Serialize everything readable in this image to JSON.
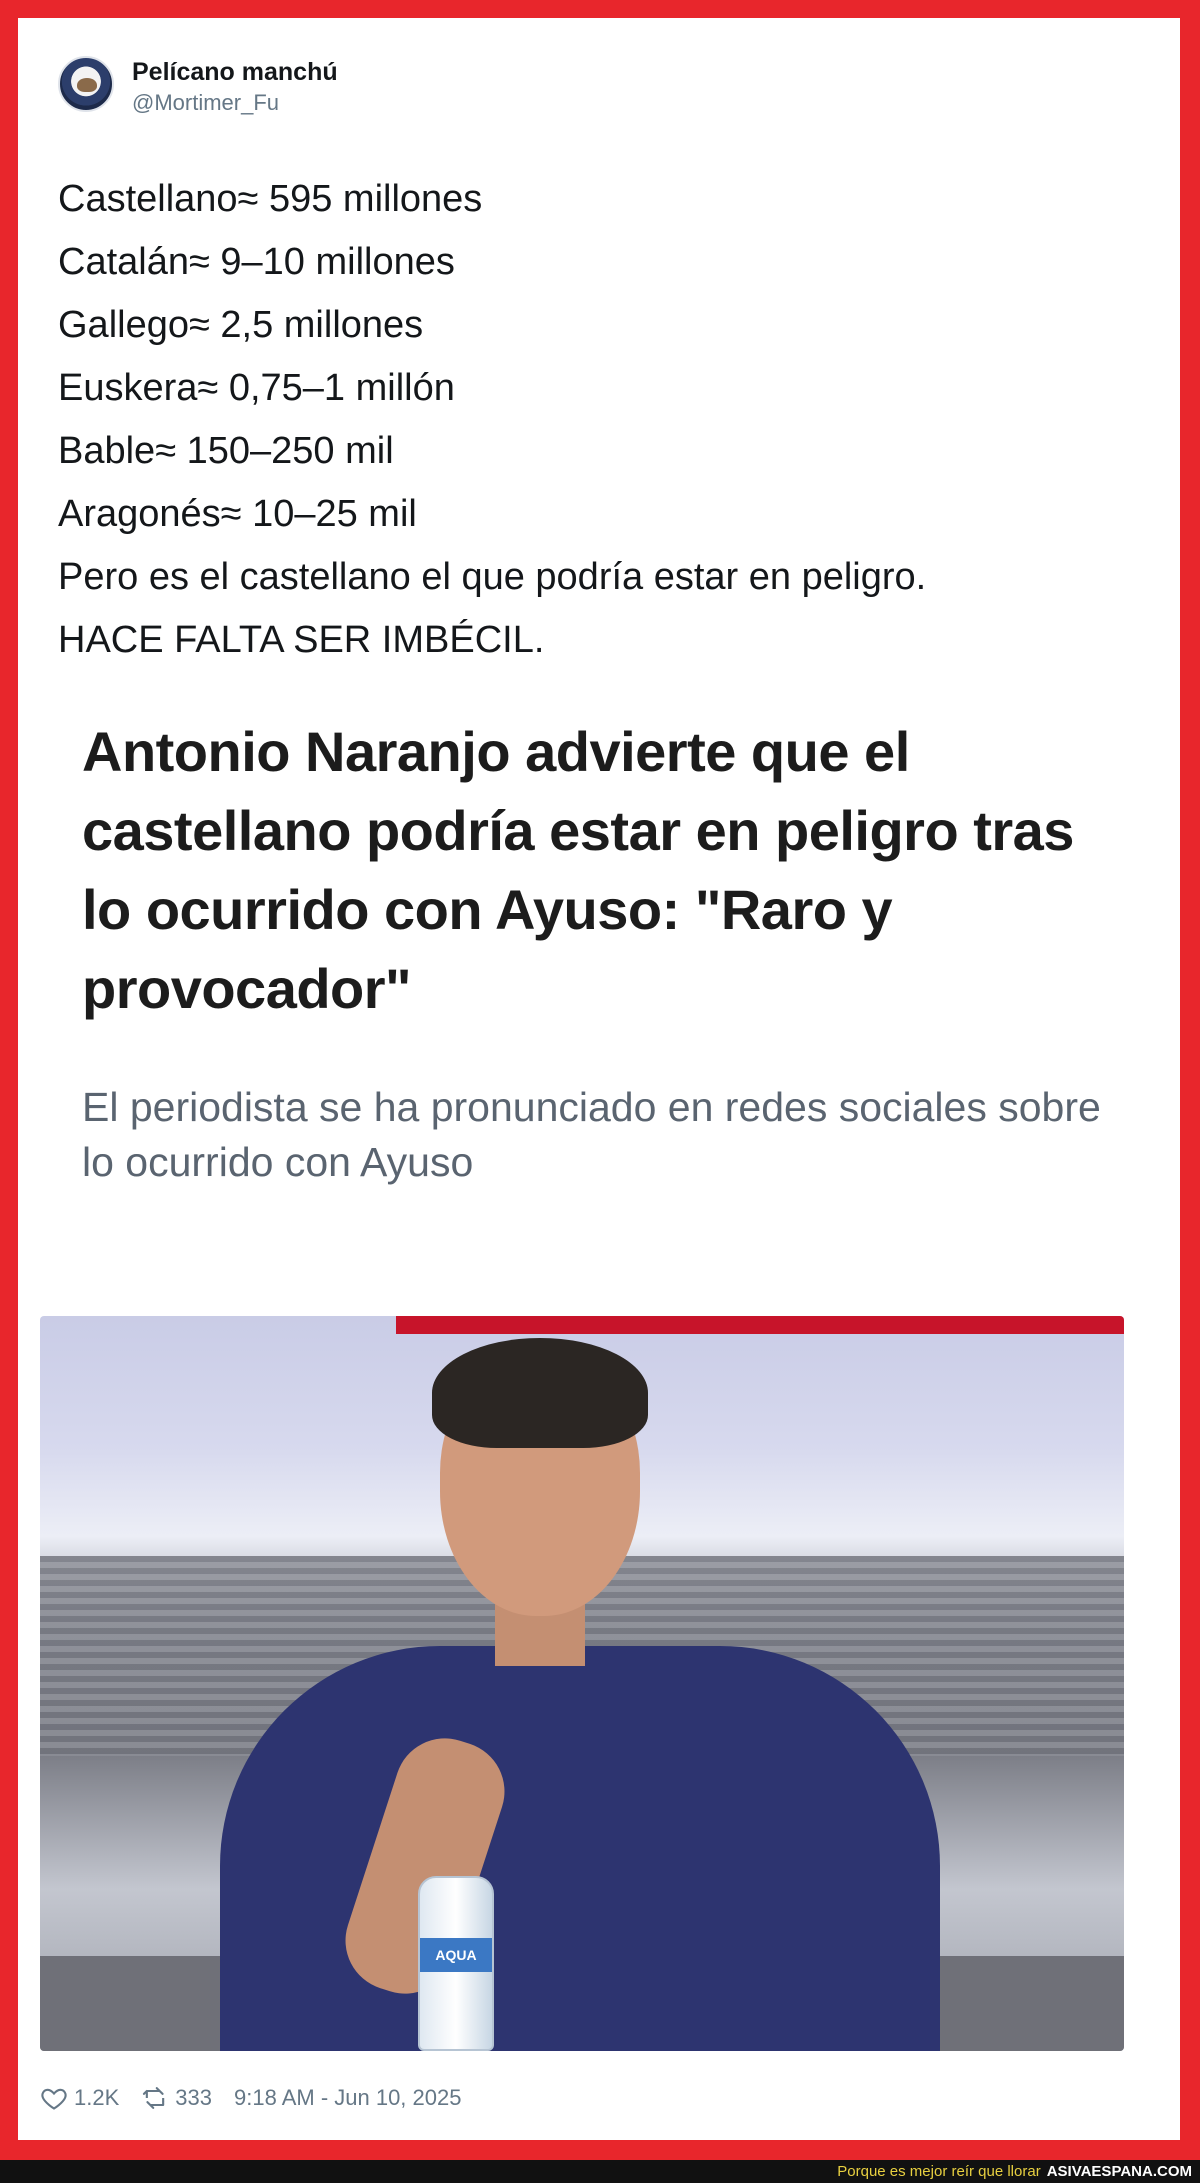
{
  "tweet": {
    "author": {
      "display_name": "Pelícano manchú",
      "handle": "@Mortimer_Fu"
    },
    "lines": [
      "Castellano≈ 595 millones",
      "Catalán≈ 9–10 millones",
      "Gallego≈ 2,5 millones",
      "Euskera≈ 0,75–1 millón",
      "Bable≈ 150–250 mil",
      "Aragonés≈ 10–25 mil",
      "Pero es el castellano el que podría estar en peligro.",
      "HACE FALTA SER IMBÉCIL."
    ],
    "article": {
      "headline": "Antonio Naranjo advierte que el castellano podría estar en peligro tras lo ocurrido con Ayuso: \"Raro y provocador\"",
      "subheadline": "El periodista se ha pronunciado en redes sociales sobre lo ocurrido con Ayuso",
      "photo_bottle_label": "AQUA"
    },
    "stats": {
      "likes": "1.2K",
      "retweets": "333",
      "timestamp": "9:18 AM - Jun 10, 2025"
    },
    "icons": {
      "like": "heart-icon",
      "retweet": "retweet-icon"
    }
  },
  "watermark": {
    "tagline": "Porque es mejor reír que llorar",
    "site": "ASIVAESPANA.COM"
  },
  "colors": {
    "frame": "#e8262c",
    "text": "#14171a",
    "muted": "#657786"
  }
}
